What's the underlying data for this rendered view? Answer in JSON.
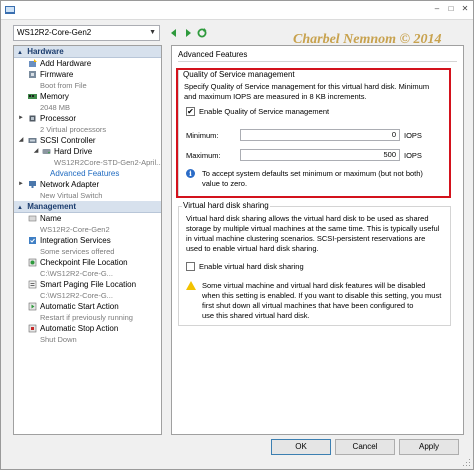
{
  "window": {
    "vm_name": "WS12R2-Core-Gen2",
    "watermark": "Charbel Nemnom © 2014",
    "controls": [
      "–",
      "□",
      "✕"
    ]
  },
  "sidebar": {
    "hardware_header": "Hardware",
    "management_header": "Management",
    "hardware_items": [
      {
        "label": "Add Hardware",
        "sub": ""
      },
      {
        "label": "Firmware",
        "sub": "Boot from File"
      },
      {
        "label": "Memory",
        "sub": "2048 MB"
      },
      {
        "label": "Processor",
        "sub": "2 Virtual processors"
      },
      {
        "label": "SCSI Controller",
        "sub": ""
      },
      {
        "label": "Hard Drive",
        "sub": "WS12R2Core-STD-Gen2-April..."
      },
      {
        "label": "Advanced Features",
        "sub": ""
      },
      {
        "label": "Network Adapter",
        "sub": "New Virtual Switch"
      }
    ],
    "management_items": [
      {
        "label": "Name",
        "sub": "WS12R2-Core-Gen2"
      },
      {
        "label": "Integration Services",
        "sub": "Some services offered"
      },
      {
        "label": "Checkpoint File Location",
        "sub": "C:\\WS12R2-Core-G..."
      },
      {
        "label": "Smart Paging File Location",
        "sub": "C:\\WS12R2-Core-G..."
      },
      {
        "label": "Automatic Start Action",
        "sub": "Restart if previously running"
      },
      {
        "label": "Automatic Stop Action",
        "sub": "Shut Down"
      }
    ]
  },
  "panel": {
    "title": "Advanced Features",
    "qos": {
      "legend": "Quality of Service management",
      "description_1": "Specify Quality of Service management for this virtual hard disk. Minimum",
      "description_2": "and maximum IOPS are measured in 8 KB increments.",
      "enable_label": "Enable Quality of Service management",
      "enabled": "✔",
      "minimum_label": "Minimum:",
      "minimum_value": "0",
      "maximum_label": "Maximum:",
      "maximum_value": "500",
      "unit": "IOPS",
      "info_1": "To accept system defaults set minimum or maximum (but not both)",
      "info_2": "value to zero."
    },
    "sharing": {
      "legend": "Virtual hard disk sharing",
      "description_1": "Virtual hard disk sharing allows the virtual hard disk to be used as shared",
      "description_2": "storage by multiple virtual machines at the same time. This is typically useful",
      "description_3": "in virtual machine clustering scenarios. SCSI-persistent reservations are",
      "description_4": "used to enable virtual hard disk sharing.",
      "enable_label": "Enable virtual hard disk sharing",
      "warning_1": "Some virtual machine and virtual hard disk features will be disabled",
      "warning_2": "when this setting is enabled. If you want to disable this setting, you must",
      "warning_3": "first shut down all virtual machines that have been configured to",
      "warning_4": "use this shared virtual hard disk."
    }
  },
  "buttons": {
    "ok": "OK",
    "cancel": "Cancel",
    "apply": "Apply"
  },
  "colors": {
    "highlight_border": "#d3121c",
    "selected_text": "#1e6ac0",
    "header_bg": "#d7e1ed"
  }
}
